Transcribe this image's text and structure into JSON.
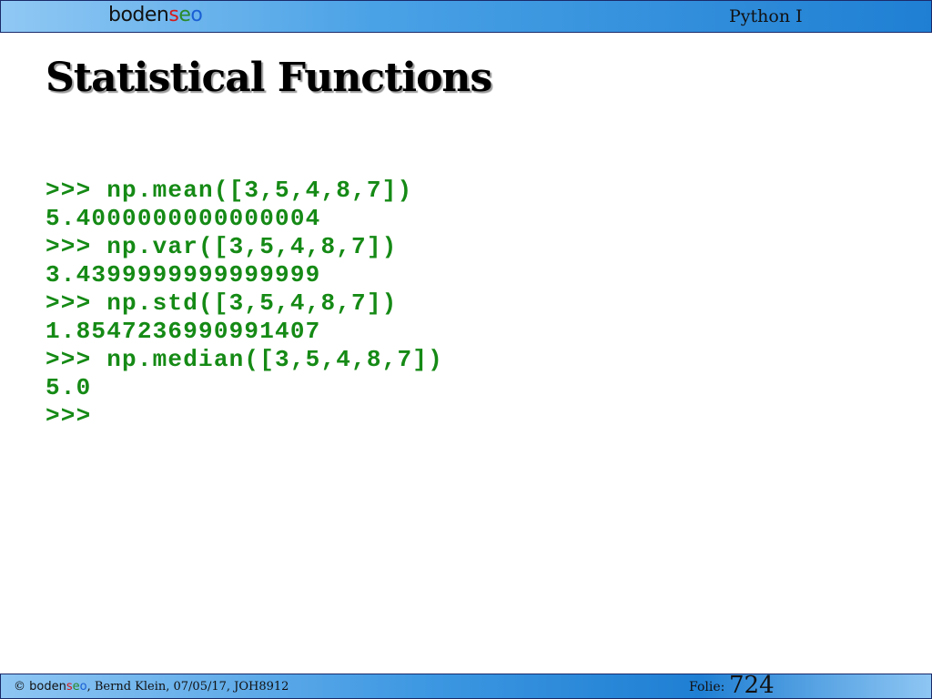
{
  "header": {
    "logo": {
      "part1": "boden",
      "part2": "s",
      "part3": "e",
      "part4": "o"
    },
    "course": "Python I"
  },
  "slide": {
    "title": "Statistical Functions",
    "code_lines": [
      ">>> np.mean([3,5,4,8,7])",
      "5.4000000000000004",
      ">>> np.var([3,5,4,8,7])",
      "3.4399999999999999",
      ">>> np.std([3,5,4,8,7])",
      "1.8547236990991407",
      ">>> np.median([3,5,4,8,7])",
      "5.0",
      ">>>"
    ],
    "code_color": "#158a15"
  },
  "footer": {
    "copyright_symbol": "©",
    "logo": {
      "part1": "boden",
      "part2": "s",
      "part3": "e",
      "part4": "o"
    },
    "credits": ", Bernd Klein, 07/05/17, JOH8912",
    "folie_label": "Folie:",
    "slide_number": "724"
  },
  "colors": {
    "bar_gradient_light": "#8ec6f3",
    "bar_gradient_dark": "#1f7fd3",
    "logo_red": "#d41a1a",
    "logo_green": "#2a8a2a",
    "logo_blue": "#1a5fd4"
  }
}
